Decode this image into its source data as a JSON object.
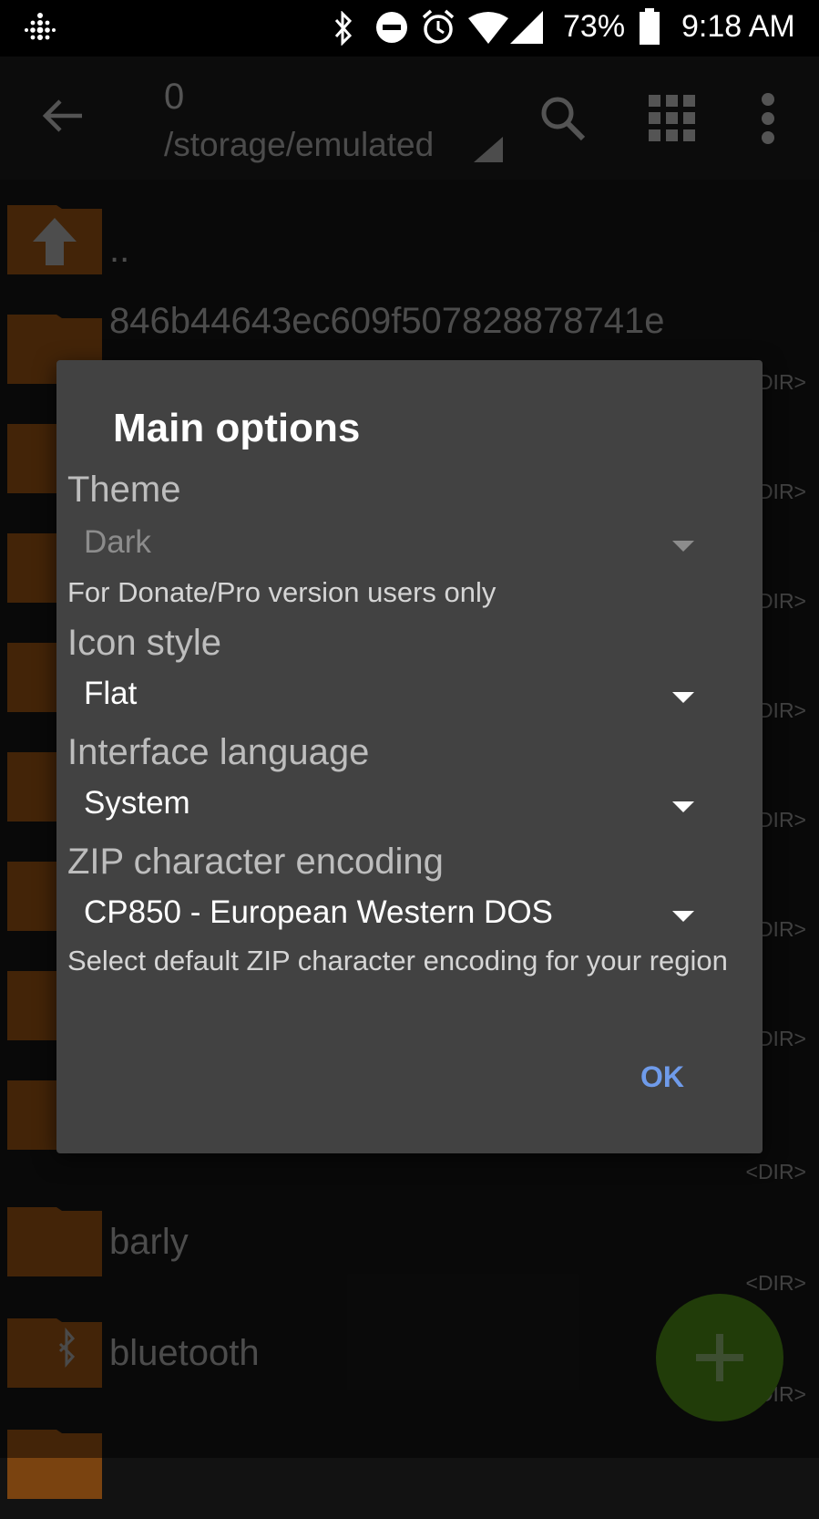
{
  "status_bar": {
    "battery_percent": "73%",
    "time": "9:18 AM",
    "icons": [
      "fitbit-icon",
      "bluetooth-icon",
      "do-not-disturb-icon",
      "alarm-icon",
      "wifi-icon",
      "signal-icon",
      "battery-icon"
    ]
  },
  "app_bar": {
    "title": "0",
    "path": "/storage/emulated",
    "icons": [
      "back-arrow-icon",
      "search-icon",
      "grid-view-icon",
      "more-vert-icon"
    ]
  },
  "file_list": {
    "items": [
      {
        "name": "..",
        "tag": ""
      },
      {
        "name": "846b44643ec609f507828878741e",
        "tag": "<DIR>"
      },
      {
        "name": "",
        "tag": "<DIR>"
      },
      {
        "name": "",
        "tag": "<DIR>"
      },
      {
        "name": "",
        "tag": "<DIR>"
      },
      {
        "name": "",
        "tag": "<DIR>"
      },
      {
        "name": "",
        "tag": "<DIR>"
      },
      {
        "name": "",
        "tag": "<DIR>"
      },
      {
        "name": "",
        "tag": "<DIR>"
      },
      {
        "name": "barly",
        "tag": "<DIR>"
      },
      {
        "name": "bluetooth",
        "tag": "<DIR>"
      }
    ]
  },
  "dialog": {
    "title": "Main options",
    "theme_label": "Theme",
    "theme_value": "Dark",
    "theme_note": "For Donate/Pro version users only",
    "icon_style_label": "Icon style",
    "icon_style_value": "Flat",
    "language_label": "Interface language",
    "language_value": "System",
    "zip_label": "ZIP character encoding",
    "zip_value": "CP850 - European Western DOS",
    "zip_note": "Select default ZIP character encoding for your region",
    "ok_label": "OK"
  },
  "colors": {
    "folder": "#7a4310",
    "accent": "#6f9bea",
    "fab": "#3d6e12",
    "dialog_bg": "#424242"
  }
}
